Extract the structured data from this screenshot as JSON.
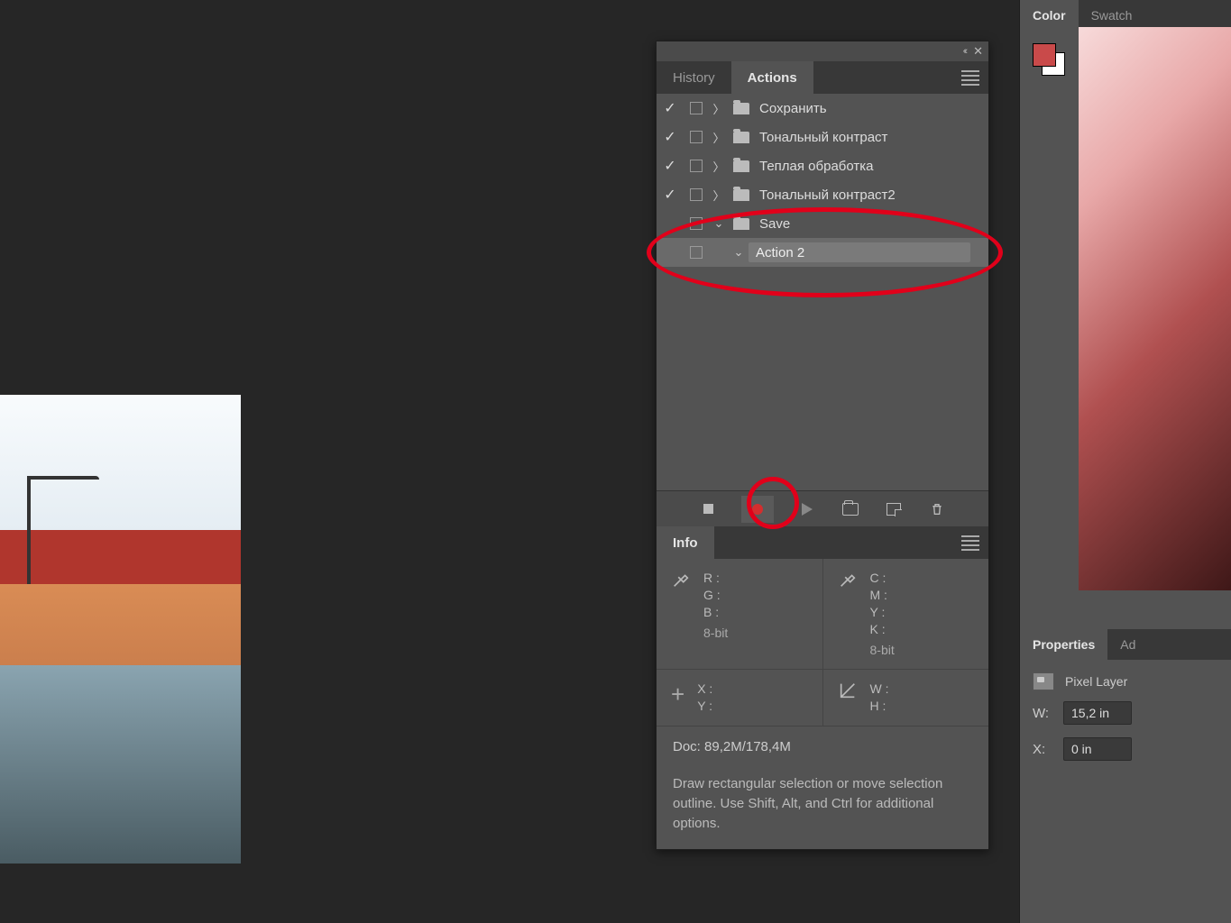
{
  "panels": {
    "history_tab": "History",
    "actions_tab": "Actions",
    "info_tab": "Info",
    "hamburger": "panel-menu"
  },
  "actions_list": [
    {
      "checked": "✓",
      "expand": "〉",
      "label": "Сохранить"
    },
    {
      "checked": "✓",
      "expand": "〉",
      "label": "Тональный контраст"
    },
    {
      "checked": "✓",
      "expand": "〉",
      "label": "Теплая обработка"
    },
    {
      "checked": "✓",
      "expand": "〉",
      "label": "Тональный контраст2"
    },
    {
      "checked": "",
      "expand": "⌄",
      "label": "Save",
      "open": true
    },
    {
      "checked": "",
      "expand": "⌄",
      "label": "Action 2",
      "child": true
    }
  ],
  "actions_footer": {
    "stop": "Stop",
    "record": "Record",
    "play": "Play",
    "newset": "New Set",
    "newaction": "New Action",
    "trash": "Delete"
  },
  "info": {
    "rgb": {
      "R": "R  :",
      "G": "G  :",
      "B": "B  :",
      "bit": "8-bit"
    },
    "cmyk": {
      "C": "C  :",
      "M": "M  :",
      "Y": "Y  :",
      "K": "K  :",
      "bit": "8-bit"
    },
    "xy": {
      "X": "X  :",
      "Y": "Y  :"
    },
    "wh": {
      "W": "W  :",
      "H": "H  :"
    },
    "doc": "Doc:  89,2M/178,4M",
    "hint": "Draw rectangular selection or move selection outline.  Use Shift, Alt, and Ctrl for additional options."
  },
  "color_panel": {
    "color_tab": "Color",
    "swatches_tab": "Swatch",
    "fg": "#c94a4a",
    "bg": "#ffffff"
  },
  "properties_panel": {
    "properties_tab": "Properties",
    "adjust_tab": "Ad",
    "kind": "Pixel Layer",
    "W_label": "W:",
    "W_value": "15,2 in",
    "X_label": "X:",
    "X_value": "0 in"
  }
}
